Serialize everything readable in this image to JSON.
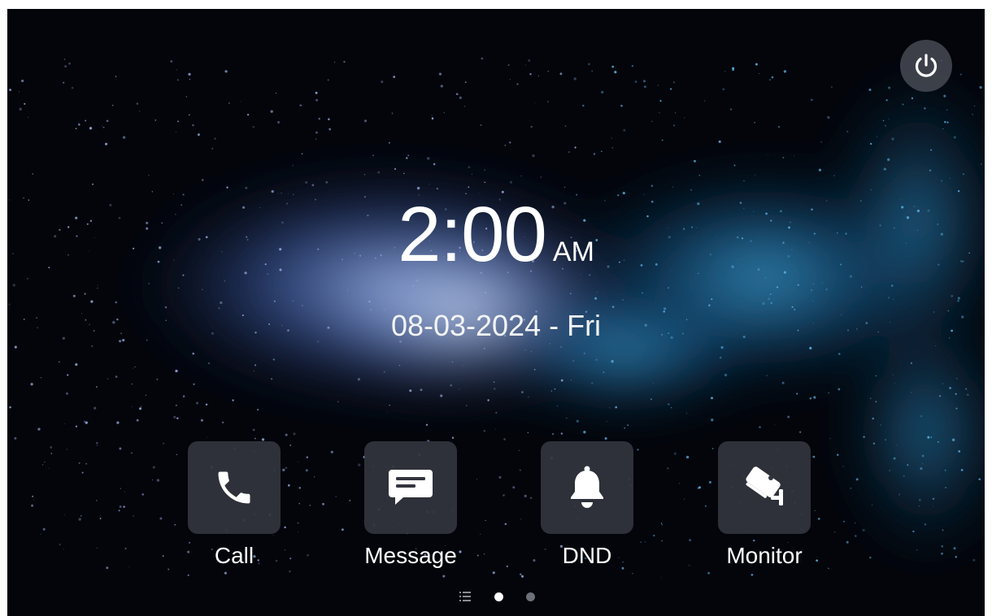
{
  "clock": {
    "time": "2:00",
    "meridiem": "AM"
  },
  "date": {
    "text": "08-03-2024 - Fri"
  },
  "power": {
    "icon": "power-icon"
  },
  "apps": [
    {
      "label": "Call",
      "icon": "phone-icon"
    },
    {
      "label": "Message",
      "icon": "message-icon"
    },
    {
      "label": "DND",
      "icon": "bell-icon"
    },
    {
      "label": "Monitor",
      "icon": "camera-icon"
    }
  ],
  "pager": {
    "icon": "list-icon",
    "pages": 2,
    "active_page": 1
  },
  "colors": {
    "tile_background": "#32353e",
    "active_dot": "#ffffff",
    "inactive_dot": "#6e7078",
    "icon": "#ffffff"
  }
}
